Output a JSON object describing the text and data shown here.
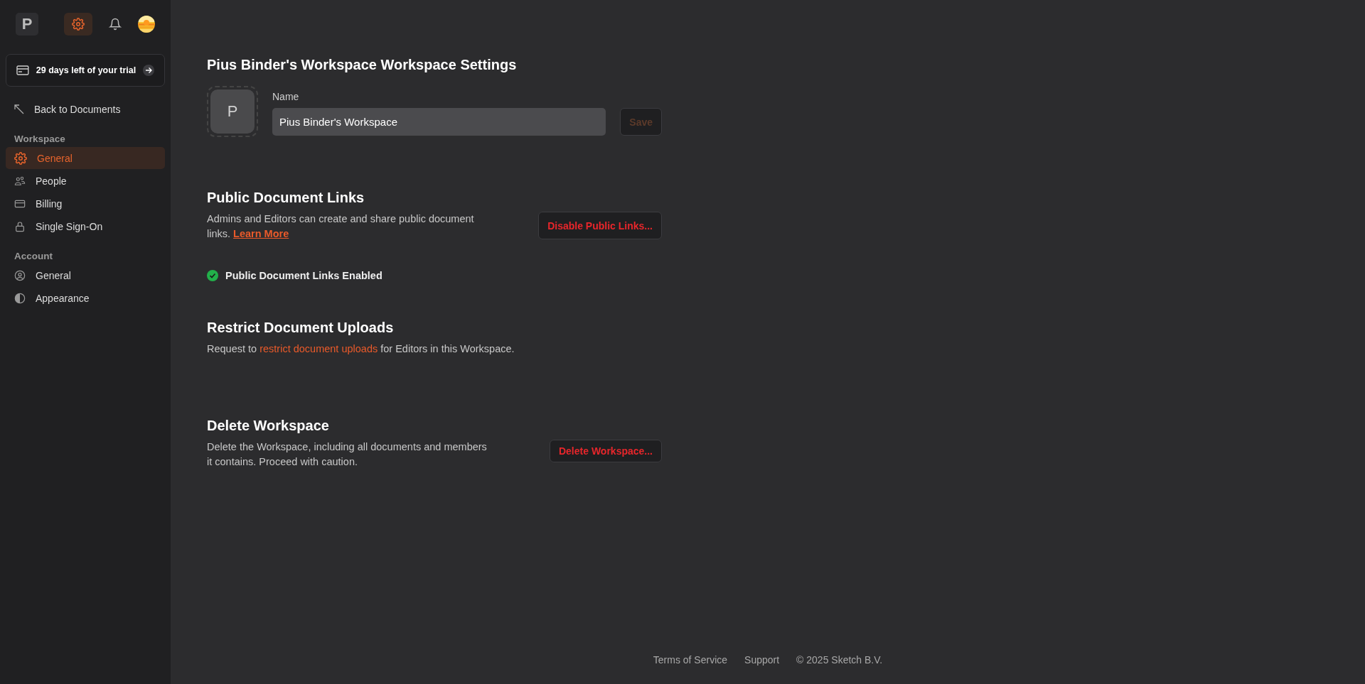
{
  "sidebar": {
    "logo": "P",
    "top_icons": [
      {
        "kind": "settings",
        "selected": true
      },
      {
        "kind": "notifications",
        "selected": false
      }
    ],
    "trial_banner": {
      "text": "29 days left of your trial"
    },
    "back_link": "Back to Documents",
    "sections": [
      {
        "heading": "Workspace",
        "items": [
          {
            "label": "General",
            "kind": "settings",
            "selected": true
          },
          {
            "label": "People",
            "kind": "people",
            "selected": false
          },
          {
            "label": "Billing",
            "kind": "card",
            "selected": false
          },
          {
            "label": "Single Sign-On",
            "kind": "lock",
            "selected": false
          }
        ]
      },
      {
        "heading": "Account",
        "items": [
          {
            "label": "General",
            "kind": "user",
            "selected": false
          },
          {
            "label": "Appearance",
            "kind": "contrast",
            "selected": false
          }
        ]
      }
    ]
  },
  "main": {
    "title": "Pius Binder's Workspace Workspace Settings",
    "workspace_avatar": "P",
    "name_field": {
      "label": "Name",
      "value": "Pius Binder's Workspace"
    },
    "save_button": {
      "label": "Save",
      "disabled": true
    },
    "public_links": {
      "heading": "Public Document Links",
      "description": "Admins and Editors can create and share public document links. ",
      "link": "Learn More",
      "button": "Disable Public Links...",
      "status": {
        "text": "Public Document Links Enabled",
        "enabled": true
      }
    },
    "restrict_uploads": {
      "heading": "Restrict Document Uploads",
      "text_before": "Request to ",
      "link": "restrict document uploads",
      "text_after": " for Editors in this Workspace."
    },
    "delete_workspace": {
      "heading": "Delete Workspace",
      "description": "Delete the Workspace, including all documents and members it contains. Proceed with caution.",
      "button": "Delete Workspace..."
    }
  },
  "footer": {
    "links": [
      "Terms of Service",
      "Support"
    ],
    "copyright": "© 2025 Sketch B.V."
  }
}
